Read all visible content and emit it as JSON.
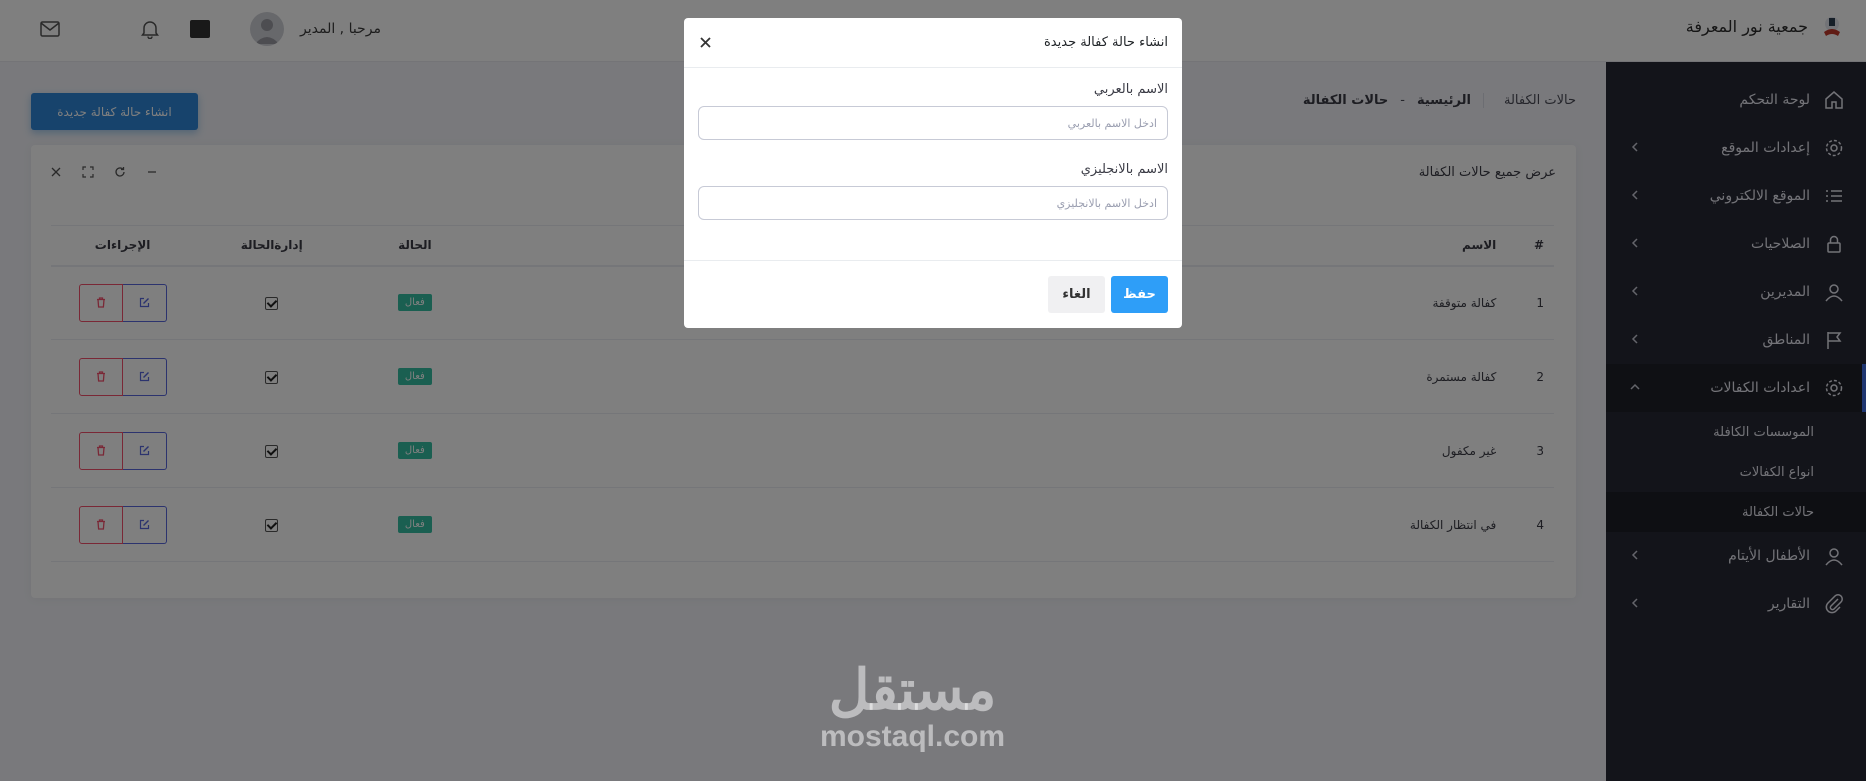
{
  "header": {
    "brand_title": "جمعية نور المعرفة",
    "greeting": "مرحبا , المدير",
    "icons": [
      "mail-icon",
      "bell-icon",
      "qr-icon",
      "avatar"
    ]
  },
  "sidebar": {
    "items": [
      {
        "label": "لوحة التحكم",
        "icon": "dashboard-icon"
      },
      {
        "label": "إعدادات الموقع",
        "icon": "gear-icon"
      },
      {
        "label": "الموقع الالكتروني",
        "icon": "list-icon"
      },
      {
        "label": "الصلاحيات",
        "icon": "lock-icon"
      },
      {
        "label": "المديرين",
        "icon": "user-icon"
      },
      {
        "label": "المناطق",
        "icon": "flag-icon"
      },
      {
        "label": "اعدادات الكفالات",
        "icon": "gear-icon"
      },
      {
        "label": "الأطفال الأيتام",
        "icon": "user-icon"
      },
      {
        "label": "التقارير",
        "icon": "paperclip-icon"
      }
    ],
    "sub_items": [
      {
        "label": "الموسسات الكافلة"
      },
      {
        "label": "انواع الكفالات"
      },
      {
        "label": "حالات الكفالة"
      }
    ]
  },
  "breadcrumb": {
    "page": "حالات الكفالة",
    "home": "الرئيسية",
    "separator": "-",
    "current": "حالات الكفالة"
  },
  "actions": {
    "create_label": "انشاء حالة كفالة جديدة"
  },
  "card": {
    "title": "عرض جميع حالات الكفالة"
  },
  "table": {
    "headers": {
      "num": "#",
      "name": "الاسم",
      "status": "الحالة",
      "manage": "إدارةالحالة",
      "actions": "الإجراءات"
    },
    "rows": [
      {
        "num": "1",
        "name": "كفالة متوقفة",
        "status": "فعال"
      },
      {
        "num": "2",
        "name": "كفالة مستمرة",
        "status": "فعال"
      },
      {
        "num": "3",
        "name": "غير مكفول",
        "status": "فعال"
      },
      {
        "num": "4",
        "name": "في انتظار الكفالة",
        "status": "فعال"
      }
    ]
  },
  "modal": {
    "title": "انشاء حالة كفالة جديدة",
    "name_ar_label": "الاسم بالعربي",
    "name_ar_placeholder": "ادخل الاسم بالعربي",
    "name_ar_value": "",
    "name_en_label": "الاسم بالانجليزي",
    "name_en_placeholder": "ادخل الاسم بالانجليزي",
    "name_en_value": "",
    "save_label": "حفظ",
    "cancel_label": "الغاء"
  },
  "watermark": {
    "arabic": "مستقل",
    "latin": "mostaql.com"
  },
  "colors": {
    "primary": "#2e86d8",
    "sidebar": "#272834",
    "success": "#34bfa3",
    "danger": "#f4516c",
    "save": "#2e9ef8"
  }
}
